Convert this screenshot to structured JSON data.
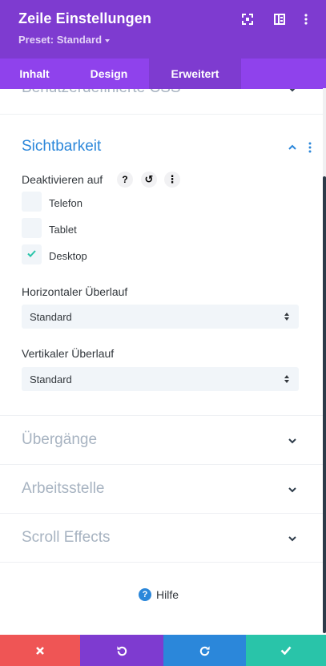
{
  "header": {
    "title": "Zeile Einstellungen",
    "preset_label": "Preset: Standard",
    "icons": [
      "fullscreen-icon",
      "split-view-icon",
      "more-vertical-icon"
    ],
    "background": "#7e3bd0"
  },
  "tabs": [
    {
      "label": "Inhalt",
      "active": false
    },
    {
      "label": "Design",
      "active": false
    },
    {
      "label": "Erweitert",
      "active": true
    }
  ],
  "sections": {
    "custom_css": {
      "title": "Benutzerdefinierte CSS",
      "expanded": false
    },
    "visibility": {
      "title": "Sichtbarkeit",
      "expanded": true,
      "disable_on": {
        "label": "Deaktivieren auf",
        "help_glyph": "?",
        "reset_glyph": "↺",
        "more_glyph": "⋮",
        "options": [
          {
            "label": "Telefon",
            "checked": false
          },
          {
            "label": "Tablet",
            "checked": false
          },
          {
            "label": "Desktop",
            "checked": true
          }
        ]
      },
      "horizontal_overflow": {
        "label": "Horizontaler Überlauf",
        "value": "Standard"
      },
      "vertical_overflow": {
        "label": "Vertikaler Überlauf",
        "value": "Standard"
      }
    },
    "transitions": {
      "title": "Übergänge",
      "expanded": false
    },
    "position": {
      "title": "Arbeitsstelle",
      "expanded": false
    },
    "scroll_effects": {
      "title": "Scroll Effects",
      "expanded": false
    }
  },
  "help": {
    "label": "Hilfe",
    "glyph": "?"
  },
  "footer": {
    "buttons": [
      {
        "name": "cancel",
        "icon": "close-icon",
        "color": "#ef5555"
      },
      {
        "name": "undo",
        "icon": "undo-icon",
        "color": "#7e3bd0"
      },
      {
        "name": "redo",
        "icon": "redo-icon",
        "color": "#2b87da"
      },
      {
        "name": "save",
        "icon": "check-icon",
        "color": "#29c4a9"
      }
    ]
  },
  "colors": {
    "accent_blue": "#2b87da",
    "tab_bar": "#8f42ec",
    "checkmark": "#29c4a9",
    "collapsed_heading": "#a7b3c1"
  }
}
